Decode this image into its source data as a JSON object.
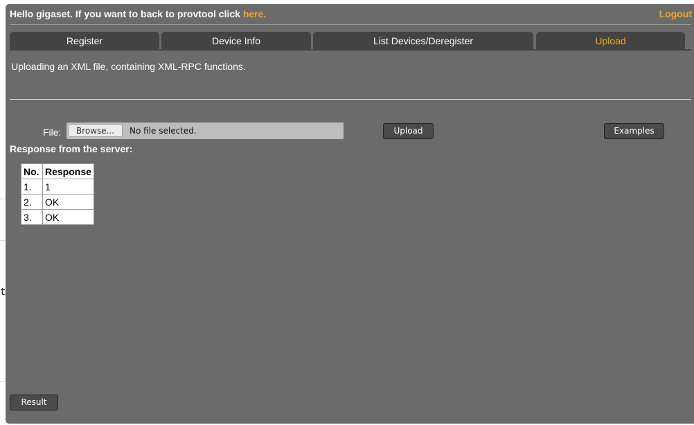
{
  "header": {
    "greeting": "Hello gigaset. If you want to back to provtool click ",
    "link": "here.",
    "logout": "Logout"
  },
  "tabs": [
    {
      "label": "Register",
      "active": false
    },
    {
      "label": "Device Info",
      "active": false
    },
    {
      "label": "List Devices/Deregister",
      "active": false
    },
    {
      "label": "Upload",
      "active": true
    }
  ],
  "description": "Uploading an XML file, containing XML-RPC functions.",
  "file": {
    "label": "File:",
    "browse": "Browse...",
    "status": "No file selected."
  },
  "buttons": {
    "upload": "Upload",
    "examples": "Examples",
    "result": "Result"
  },
  "response": {
    "label": "Response from the server:",
    "columns": [
      "No.",
      "Response"
    ],
    "rows": [
      [
        "1.",
        "1"
      ],
      [
        "2.",
        "OK"
      ],
      [
        "3.",
        "OK"
      ]
    ]
  },
  "background_code": "tDevices</methodName>",
  "colors": {
    "panel": "#6b6b6b",
    "tab": "#434343",
    "accent": "#f5a623"
  }
}
